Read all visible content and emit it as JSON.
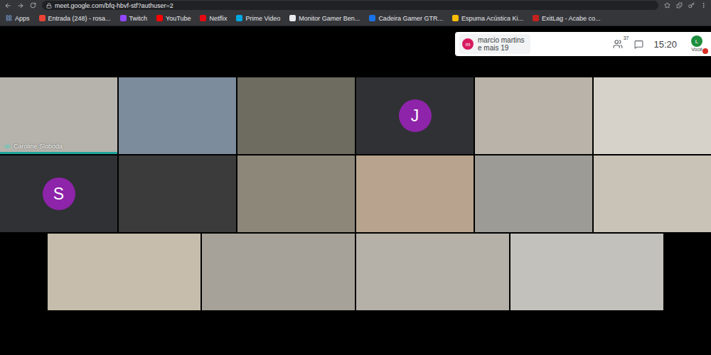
{
  "browser": {
    "url": "meet.google.com/bfq-hbvf-stf?authuser=2",
    "bookmarks": [
      {
        "label": "Apps",
        "kind": "apps",
        "color": "#8ab4f8"
      },
      {
        "label": "Entrada (248) - rosa...",
        "kind": "link",
        "color": "#ea4335"
      },
      {
        "label": "Twitch",
        "kind": "link",
        "color": "#9146ff"
      },
      {
        "label": "YouTube",
        "kind": "link",
        "color": "#ff0000"
      },
      {
        "label": "Netflix",
        "kind": "link",
        "color": "#e50914"
      },
      {
        "label": "Prime Video",
        "kind": "link",
        "color": "#00a8e1"
      },
      {
        "label": "Monitor Gamer Ben...",
        "kind": "link",
        "color": "#e8eaed"
      },
      {
        "label": "Cadeira Gamer GTR...",
        "kind": "link",
        "color": "#1a73e8"
      },
      {
        "label": "Espuma Acústica Ki...",
        "kind": "link",
        "color": "#fbbc04"
      },
      {
        "label": "ExitLag - Acabe co...",
        "kind": "link",
        "color": "#c5221f"
      }
    ]
  },
  "meet": {
    "preview": {
      "avatar": "m",
      "color": "#d81b60",
      "lines": [
        "marcio martins",
        "e mais 19"
      ]
    },
    "participants": "37",
    "time": "15:20",
    "self": {
      "avatar": "L",
      "label": "Você",
      "color": "#1e8e3e",
      "notification": true
    }
  },
  "tiles": [
    [
      {
        "kind": "video",
        "color": "#b5b3ab",
        "name": "Caroline Sloboda",
        "speaking": true
      },
      {
        "kind": "video",
        "color": "#7d8c9c",
        "speaking": false
      },
      {
        "kind": "video",
        "color": "#6e6c60",
        "speaking": false
      },
      {
        "kind": "avatar",
        "color": "#303134",
        "avatar": "J",
        "avatar_color": "#8e24aa",
        "speaking": false
      },
      {
        "kind": "video",
        "color": "#b9b3a9",
        "speaking": false
      },
      {
        "kind": "video",
        "color": "#d6d2ca",
        "speaking": false
      }
    ],
    [
      {
        "kind": "avatar",
        "color": "#303134",
        "avatar": "S",
        "avatar_color": "#8e24aa",
        "speaking": false
      },
      {
        "kind": "video",
        "color": "#3b3b3b",
        "speaking": false
      },
      {
        "kind": "video",
        "color": "#8c8779",
        "speaking": false
      },
      {
        "kind": "video",
        "color": "#b7a38e",
        "speaking": false
      },
      {
        "kind": "video",
        "color": "#9c9b95",
        "speaking": false
      },
      {
        "kind": "video",
        "color": "#c8c2b7",
        "speaking": false
      }
    ],
    [
      {
        "kind": "video",
        "color": "#c6bdac",
        "speaking": false
      },
      {
        "kind": "video",
        "color": "#a7a299",
        "speaking": false
      },
      {
        "kind": "video",
        "color": "#b5b0a8",
        "speaking": false
      },
      {
        "kind": "video",
        "color": "#c3c1bb",
        "speaking": false
      }
    ]
  ]
}
